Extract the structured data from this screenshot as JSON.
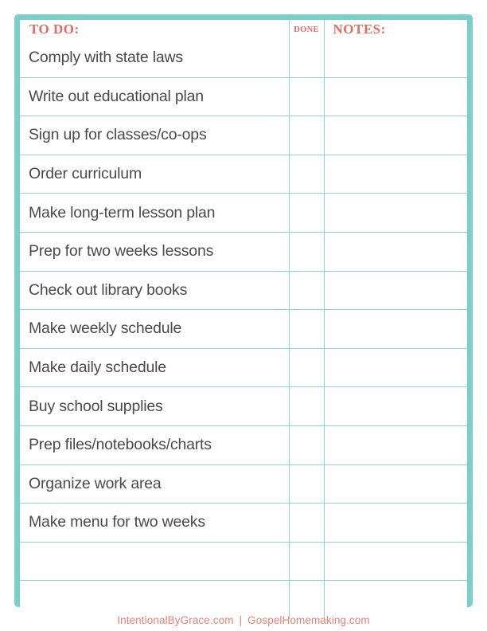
{
  "sheet": {
    "border_color": "#7ACFC8",
    "grid_color": "#8ED4CD",
    "accent_color": "#E8685D",
    "text_color": "#4A4A4A"
  },
  "header": {
    "todo_label": "TO DO:",
    "done_label": "DONE",
    "notes_label": "NOTES:"
  },
  "rows": [
    {
      "task": "Comply with state laws",
      "done": "",
      "notes": ""
    },
    {
      "task": "Write out educational plan",
      "done": "",
      "notes": ""
    },
    {
      "task": "Sign up for classes/co-ops",
      "done": "",
      "notes": ""
    },
    {
      "task": "Order curriculum",
      "done": "",
      "notes": ""
    },
    {
      "task": "Make long-term lesson plan",
      "done": "",
      "notes": ""
    },
    {
      "task": "Prep for two weeks lessons",
      "done": "",
      "notes": ""
    },
    {
      "task": "Check out library books",
      "done": "",
      "notes": ""
    },
    {
      "task": "Make weekly schedule",
      "done": "",
      "notes": ""
    },
    {
      "task": "Make daily schedule",
      "done": "",
      "notes": ""
    },
    {
      "task": "Buy school supplies",
      "done": "",
      "notes": ""
    },
    {
      "task": "Prep files/notebooks/charts",
      "done": "",
      "notes": ""
    },
    {
      "task": "Organize work area",
      "done": "",
      "notes": ""
    },
    {
      "task": "Make menu for two weeks",
      "done": "",
      "notes": ""
    },
    {
      "task": "",
      "done": "",
      "notes": ""
    },
    {
      "task": "",
      "done": "",
      "notes": ""
    }
  ],
  "footer": {
    "site_left": "IntentionalByGrace.com",
    "separator": "|",
    "site_right": "GospelHomemaking.com"
  }
}
